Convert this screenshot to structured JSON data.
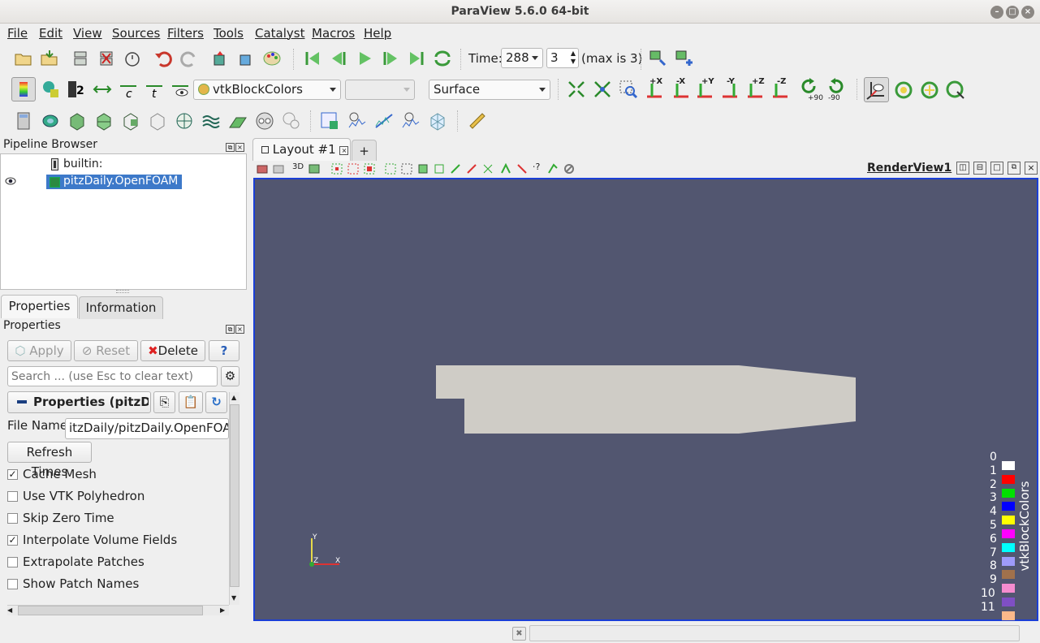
{
  "window": {
    "title": "ParaView 5.6.0 64-bit"
  },
  "menu": [
    "File",
    "Edit",
    "View",
    "Sources",
    "Filters",
    "Tools",
    "Catalyst",
    "Macros",
    "Help"
  ],
  "time": {
    "label": "Time:",
    "value": "288",
    "index": "3",
    "max": "(max is 3)"
  },
  "coloring": {
    "array": "vtkBlockColors",
    "component": "",
    "representation": "Surface"
  },
  "camera_buttons": [
    "+X",
    "-X",
    "+Y",
    "-Y",
    "+Z",
    "-Z",
    "+90",
    "-90"
  ],
  "pipeline": {
    "title": "Pipeline Browser",
    "items": [
      {
        "label": "builtin:"
      },
      {
        "label": "pitzDaily.OpenFOAM"
      }
    ]
  },
  "tabs": {
    "properties": "Properties",
    "information": "Information"
  },
  "properties": {
    "title": "Properties",
    "apply": "Apply",
    "reset": "Reset",
    "delete": "Delete",
    "help": "?",
    "search_placeholder": "Search ... (use Esc to clear text)",
    "section": "Properties (pitzDai",
    "file_name_label": "File Name",
    "file_name_value": "itzDaily/pitzDaily.OpenFOAM",
    "refresh": "Refresh Times",
    "checkboxes": [
      {
        "label": "Cache Mesh",
        "checked": true
      },
      {
        "label": "Use VTK Polyhedron",
        "checked": false
      },
      {
        "label": "Skip Zero Time",
        "checked": false
      },
      {
        "label": "Interpolate Volume Fields",
        "checked": true
      },
      {
        "label": "Extrapolate Patches",
        "checked": false
      },
      {
        "label": "Show Patch Names",
        "checked": false
      }
    ]
  },
  "layout": {
    "tab": "Layout #1",
    "add": "+",
    "view_name": "RenderView1",
    "mode_3d": "3D"
  },
  "axes": {
    "x": "X",
    "y": "Y",
    "z": "Z"
  },
  "legend": {
    "title": "vtkBlockColors",
    "entries": [
      {
        "label": "0",
        "color": "#ffffff"
      },
      {
        "label": "1",
        "color": "#ff0000"
      },
      {
        "label": "2",
        "color": "#00e000"
      },
      {
        "label": "3",
        "color": "#0000ff"
      },
      {
        "label": "4",
        "color": "#ffff00"
      },
      {
        "label": "5",
        "color": "#ff00ff"
      },
      {
        "label": "6",
        "color": "#00ffff"
      },
      {
        "label": "7",
        "color": "#9e9bfa"
      },
      {
        "label": "8",
        "color": "#a1714c"
      },
      {
        "label": "9",
        "color": "#f58ccf"
      },
      {
        "label": "10",
        "color": "#7f4fc4"
      },
      {
        "label": "11",
        "color": "#fdb98a"
      }
    ]
  },
  "colors": {
    "render_bg": "#525670",
    "geometry": "#cfccc6",
    "active_view_border": "#1b3fd6",
    "selection": "#3d79c9"
  }
}
